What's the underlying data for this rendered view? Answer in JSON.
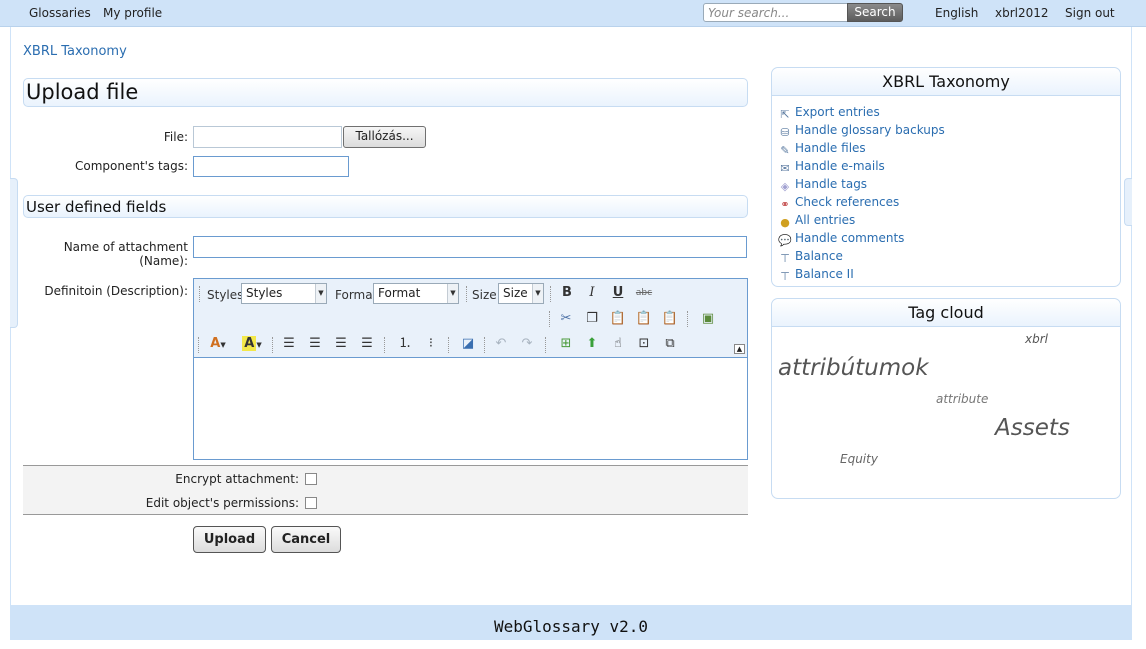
{
  "topnav": {
    "glossaries": "Glossaries",
    "my_profile": "My profile",
    "search_placeholder": "Your search...",
    "search_button": "Search",
    "language": "English",
    "user": "xbrl2012",
    "sign_out": "Sign out"
  },
  "breadcrumb": "XBRL Taxonomy",
  "upload": {
    "title": "Upload file",
    "file_label": "File:",
    "browse_button": "Tallózás...",
    "tags_label": "Component's tags:"
  },
  "udf": {
    "title": "User defined fields",
    "name_label_1": "Name of attachment",
    "name_label_2": "(Name):",
    "definition_label": "Definitoin (Description):"
  },
  "editor": {
    "styles_label": "Styles",
    "styles_value": "Styles",
    "format_label": "Format",
    "format_value": "Format",
    "size_label": "Size",
    "size_value": "Size",
    "bold": "B",
    "italic": "I",
    "underline": "U",
    "strike": "abc",
    "font_color": "A",
    "bg_color": "A"
  },
  "options": {
    "encrypt_label": "Encrypt attachment:",
    "permissions_label": "Edit object's permissions:"
  },
  "buttons": {
    "upload": "Upload",
    "cancel": "Cancel"
  },
  "sidebar": {
    "title": "XBRL Taxonomy",
    "items": [
      {
        "label": "Export entries",
        "icon": "export-icon"
      },
      {
        "label": "Handle glossary backups",
        "icon": "backup-icon"
      },
      {
        "label": "Handle files",
        "icon": "files-icon"
      },
      {
        "label": "Handle e-mails",
        "icon": "mail-icon"
      },
      {
        "label": "Handle tags",
        "icon": "tag-icon"
      },
      {
        "label": "Check references",
        "icon": "references-icon"
      },
      {
        "label": "All entries",
        "icon": "entries-icon"
      },
      {
        "label": "Handle comments",
        "icon": "comment-icon"
      },
      {
        "label": "Balance",
        "icon": "hierarchy-icon"
      },
      {
        "label": "Balance II",
        "icon": "hierarchy-icon"
      }
    ]
  },
  "tagcloud": {
    "title": "Tag cloud",
    "tags": [
      "xbrl",
      "attribútumok",
      "attribute",
      "Assets",
      "Equity"
    ]
  },
  "footer": "WebGlossary v2.0"
}
